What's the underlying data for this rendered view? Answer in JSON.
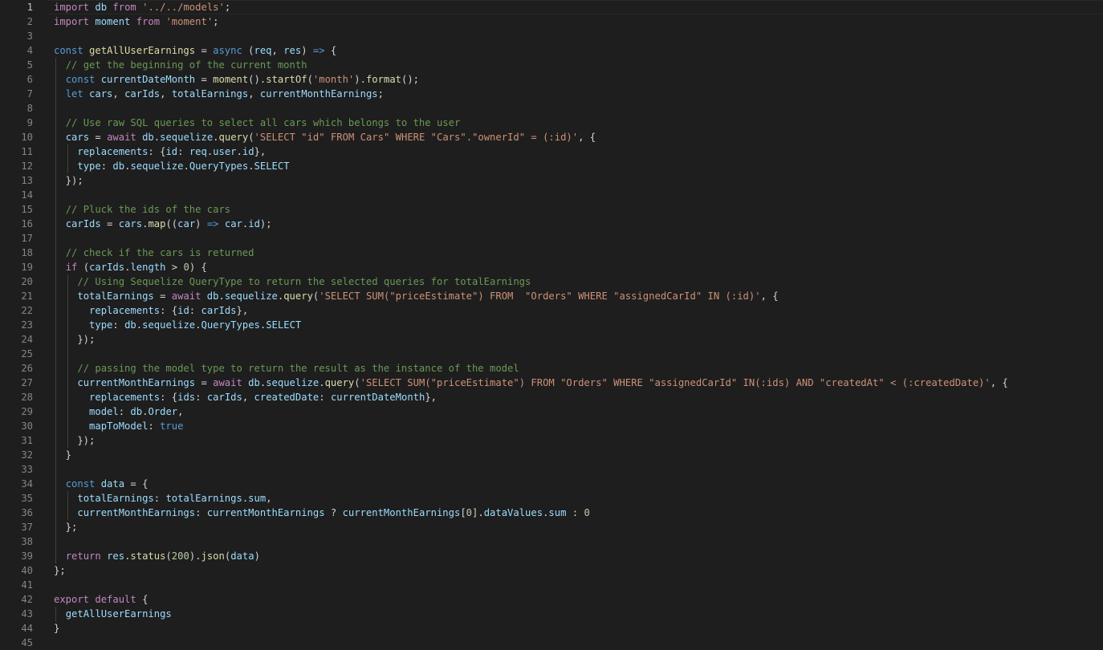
{
  "editor": {
    "lines": [
      [
        [
          "kw",
          "import"
        ],
        [
          "pl",
          " "
        ],
        [
          "vr",
          "db"
        ],
        [
          "pl",
          " "
        ],
        [
          "kw",
          "from"
        ],
        [
          "pl",
          " "
        ],
        [
          "st",
          "'../../models'"
        ],
        [
          "pl",
          ";"
        ]
      ],
      [
        [
          "kw",
          "import"
        ],
        [
          "pl",
          " "
        ],
        [
          "vr",
          "moment"
        ],
        [
          "pl",
          " "
        ],
        [
          "kw",
          "from"
        ],
        [
          "pl",
          " "
        ],
        [
          "st",
          "'moment'"
        ],
        [
          "pl",
          ";"
        ]
      ],
      [],
      [
        [
          "sk",
          "const"
        ],
        [
          "pl",
          " "
        ],
        [
          "fn",
          "getAllUserEarnings"
        ],
        [
          "pl",
          " = "
        ],
        [
          "sk",
          "async"
        ],
        [
          "pl",
          " ("
        ],
        [
          "vr",
          "req"
        ],
        [
          "pl",
          ", "
        ],
        [
          "vr",
          "res"
        ],
        [
          "pl",
          ") "
        ],
        [
          "sk",
          "=>"
        ],
        [
          "pl",
          " {"
        ]
      ],
      [
        [
          "pl",
          "  "
        ],
        [
          "cm",
          "// get the beginning of the current month"
        ]
      ],
      [
        [
          "pl",
          "  "
        ],
        [
          "sk",
          "const"
        ],
        [
          "pl",
          " "
        ],
        [
          "vr",
          "currentDateMonth"
        ],
        [
          "pl",
          " = "
        ],
        [
          "fn",
          "moment"
        ],
        [
          "pl",
          "()."
        ],
        [
          "fn",
          "startOf"
        ],
        [
          "pl",
          "("
        ],
        [
          "st",
          "'month'"
        ],
        [
          "pl",
          ")."
        ],
        [
          "fn",
          "format"
        ],
        [
          "pl",
          "();"
        ]
      ],
      [
        [
          "pl",
          "  "
        ],
        [
          "sk",
          "let"
        ],
        [
          "pl",
          " "
        ],
        [
          "vr",
          "cars"
        ],
        [
          "pl",
          ", "
        ],
        [
          "vr",
          "carIds"
        ],
        [
          "pl",
          ", "
        ],
        [
          "vr",
          "totalEarnings"
        ],
        [
          "pl",
          ", "
        ],
        [
          "vr",
          "currentMonthEarnings"
        ],
        [
          "pl",
          ";"
        ]
      ],
      [],
      [
        [
          "pl",
          "  "
        ],
        [
          "cm",
          "// Use raw SQL queries to select all cars which belongs to the user"
        ]
      ],
      [
        [
          "pl",
          "  "
        ],
        [
          "vr",
          "cars"
        ],
        [
          "pl",
          " = "
        ],
        [
          "kw",
          "await"
        ],
        [
          "pl",
          " "
        ],
        [
          "vr",
          "db"
        ],
        [
          "pl",
          "."
        ],
        [
          "vr",
          "sequelize"
        ],
        [
          "pl",
          "."
        ],
        [
          "fn",
          "query"
        ],
        [
          "pl",
          "("
        ],
        [
          "st",
          "'SELECT \"id\" FROM Cars\" WHERE \"Cars\".\"ownerId\" = (:id)'"
        ],
        [
          "pl",
          ", {"
        ]
      ],
      [
        [
          "pl",
          "    "
        ],
        [
          "vr",
          "replacements"
        ],
        [
          "pl",
          ": {"
        ],
        [
          "vr",
          "id"
        ],
        [
          "pl",
          ": "
        ],
        [
          "vr",
          "req"
        ],
        [
          "pl",
          "."
        ],
        [
          "vr",
          "user"
        ],
        [
          "pl",
          "."
        ],
        [
          "vr",
          "id"
        ],
        [
          "pl",
          "},"
        ]
      ],
      [
        [
          "pl",
          "    "
        ],
        [
          "vr",
          "type"
        ],
        [
          "pl",
          ": "
        ],
        [
          "vr",
          "db"
        ],
        [
          "pl",
          "."
        ],
        [
          "vr",
          "sequelize"
        ],
        [
          "pl",
          "."
        ],
        [
          "vr",
          "QueryTypes"
        ],
        [
          "pl",
          "."
        ],
        [
          "vr",
          "SELECT"
        ]
      ],
      [
        [
          "pl",
          "  });"
        ]
      ],
      [],
      [
        [
          "pl",
          "  "
        ],
        [
          "cm",
          "// Pluck the ids of the cars"
        ]
      ],
      [
        [
          "pl",
          "  "
        ],
        [
          "vr",
          "carIds"
        ],
        [
          "pl",
          " = "
        ],
        [
          "vr",
          "cars"
        ],
        [
          "pl",
          "."
        ],
        [
          "fn",
          "map"
        ],
        [
          "pl",
          "(("
        ],
        [
          "vr",
          "car"
        ],
        [
          "pl",
          ") "
        ],
        [
          "sk",
          "=>"
        ],
        [
          "pl",
          " "
        ],
        [
          "vr",
          "car"
        ],
        [
          "pl",
          "."
        ],
        [
          "vr",
          "id"
        ],
        [
          "pl",
          ");"
        ]
      ],
      [],
      [
        [
          "pl",
          "  "
        ],
        [
          "cm",
          "// check if the cars is returned"
        ]
      ],
      [
        [
          "pl",
          "  "
        ],
        [
          "kw",
          "if"
        ],
        [
          "pl",
          " ("
        ],
        [
          "vr",
          "carIds"
        ],
        [
          "pl",
          "."
        ],
        [
          "vr",
          "length"
        ],
        [
          "pl",
          " > "
        ],
        [
          "nu",
          "0"
        ],
        [
          "pl",
          ") {"
        ]
      ],
      [
        [
          "pl",
          "    "
        ],
        [
          "cm",
          "// Using Sequelize QueryType to return the selected queries for totalEarnings"
        ]
      ],
      [
        [
          "pl",
          "    "
        ],
        [
          "vr",
          "totalEarnings"
        ],
        [
          "pl",
          " = "
        ],
        [
          "kw",
          "await"
        ],
        [
          "pl",
          " "
        ],
        [
          "vr",
          "db"
        ],
        [
          "pl",
          "."
        ],
        [
          "vr",
          "sequelize"
        ],
        [
          "pl",
          "."
        ],
        [
          "fn",
          "query"
        ],
        [
          "pl",
          "("
        ],
        [
          "st",
          "'SELECT SUM(\"priceEstimate\") FROM  \"Orders\" WHERE \"assignedCarId\" IN (:id)'"
        ],
        [
          "pl",
          ", {"
        ]
      ],
      [
        [
          "pl",
          "      "
        ],
        [
          "vr",
          "replacements"
        ],
        [
          "pl",
          ": {"
        ],
        [
          "vr",
          "id"
        ],
        [
          "pl",
          ": "
        ],
        [
          "vr",
          "carIds"
        ],
        [
          "pl",
          "},"
        ]
      ],
      [
        [
          "pl",
          "      "
        ],
        [
          "vr",
          "type"
        ],
        [
          "pl",
          ": "
        ],
        [
          "vr",
          "db"
        ],
        [
          "pl",
          "."
        ],
        [
          "vr",
          "sequelize"
        ],
        [
          "pl",
          "."
        ],
        [
          "vr",
          "QueryTypes"
        ],
        [
          "pl",
          "."
        ],
        [
          "vr",
          "SELECT"
        ]
      ],
      [
        [
          "pl",
          "    });"
        ]
      ],
      [],
      [
        [
          "pl",
          "    "
        ],
        [
          "cm",
          "// passing the model type to return the result as the instance of the model"
        ]
      ],
      [
        [
          "pl",
          "    "
        ],
        [
          "vr",
          "currentMonthEarnings"
        ],
        [
          "pl",
          " = "
        ],
        [
          "kw",
          "await"
        ],
        [
          "pl",
          " "
        ],
        [
          "vr",
          "db"
        ],
        [
          "pl",
          "."
        ],
        [
          "vr",
          "sequelize"
        ],
        [
          "pl",
          "."
        ],
        [
          "fn",
          "query"
        ],
        [
          "pl",
          "("
        ],
        [
          "st",
          "'SELECT SUM(\"priceEstimate\") FROM \"Orders\" WHERE \"assignedCarId\" IN(:ids) AND \"createdAt\" < (:createdDate)'"
        ],
        [
          "pl",
          ", {"
        ]
      ],
      [
        [
          "pl",
          "      "
        ],
        [
          "vr",
          "replacements"
        ],
        [
          "pl",
          ": {"
        ],
        [
          "vr",
          "ids"
        ],
        [
          "pl",
          ": "
        ],
        [
          "vr",
          "carIds"
        ],
        [
          "pl",
          ", "
        ],
        [
          "vr",
          "createdDate"
        ],
        [
          "pl",
          ": "
        ],
        [
          "vr",
          "currentDateMonth"
        ],
        [
          "pl",
          "},"
        ]
      ],
      [
        [
          "pl",
          "      "
        ],
        [
          "vr",
          "model"
        ],
        [
          "pl",
          ": "
        ],
        [
          "vr",
          "db"
        ],
        [
          "pl",
          "."
        ],
        [
          "vr",
          "Order"
        ],
        [
          "pl",
          ","
        ]
      ],
      [
        [
          "pl",
          "      "
        ],
        [
          "vr",
          "mapToModel"
        ],
        [
          "pl",
          ": "
        ],
        [
          "sk",
          "true"
        ]
      ],
      [
        [
          "pl",
          "    });"
        ]
      ],
      [
        [
          "pl",
          "  }"
        ]
      ],
      [],
      [
        [
          "pl",
          "  "
        ],
        [
          "sk",
          "const"
        ],
        [
          "pl",
          " "
        ],
        [
          "vr",
          "data"
        ],
        [
          "pl",
          " = {"
        ]
      ],
      [
        [
          "pl",
          "    "
        ],
        [
          "vr",
          "totalEarnings"
        ],
        [
          "pl",
          ": "
        ],
        [
          "vr",
          "totalEarnings"
        ],
        [
          "pl",
          "."
        ],
        [
          "vr",
          "sum"
        ],
        [
          "pl",
          ","
        ]
      ],
      [
        [
          "pl",
          "    "
        ],
        [
          "vr",
          "currentMonthEarnings"
        ],
        [
          "pl",
          ": "
        ],
        [
          "vr",
          "currentMonthEarnings"
        ],
        [
          "pl",
          " ? "
        ],
        [
          "vr",
          "currentMonthEarnings"
        ],
        [
          "pl",
          "["
        ],
        [
          "nu",
          "0"
        ],
        [
          "pl",
          "]."
        ],
        [
          "vr",
          "dataValues"
        ],
        [
          "pl",
          "."
        ],
        [
          "vr",
          "sum"
        ],
        [
          "pl",
          " : "
        ],
        [
          "nu",
          "0"
        ]
      ],
      [
        [
          "pl",
          "  };"
        ]
      ],
      [],
      [
        [
          "pl",
          "  "
        ],
        [
          "kw",
          "return"
        ],
        [
          "pl",
          " "
        ],
        [
          "vr",
          "res"
        ],
        [
          "pl",
          "."
        ],
        [
          "fn",
          "status"
        ],
        [
          "pl",
          "("
        ],
        [
          "nu",
          "200"
        ],
        [
          "pl",
          ")."
        ],
        [
          "fn",
          "json"
        ],
        [
          "pl",
          "("
        ],
        [
          "vr",
          "data"
        ],
        [
          "pl",
          ")"
        ]
      ],
      [
        [
          "pl",
          "};"
        ]
      ],
      [],
      [
        [
          "kw",
          "export"
        ],
        [
          "pl",
          " "
        ],
        [
          "kw",
          "default"
        ],
        [
          "pl",
          " {"
        ]
      ],
      [
        [
          "pl",
          "  "
        ],
        [
          "vr",
          "getAllUserEarnings"
        ]
      ],
      [
        [
          "pl",
          "}"
        ]
      ],
      []
    ],
    "active_line": 1
  }
}
